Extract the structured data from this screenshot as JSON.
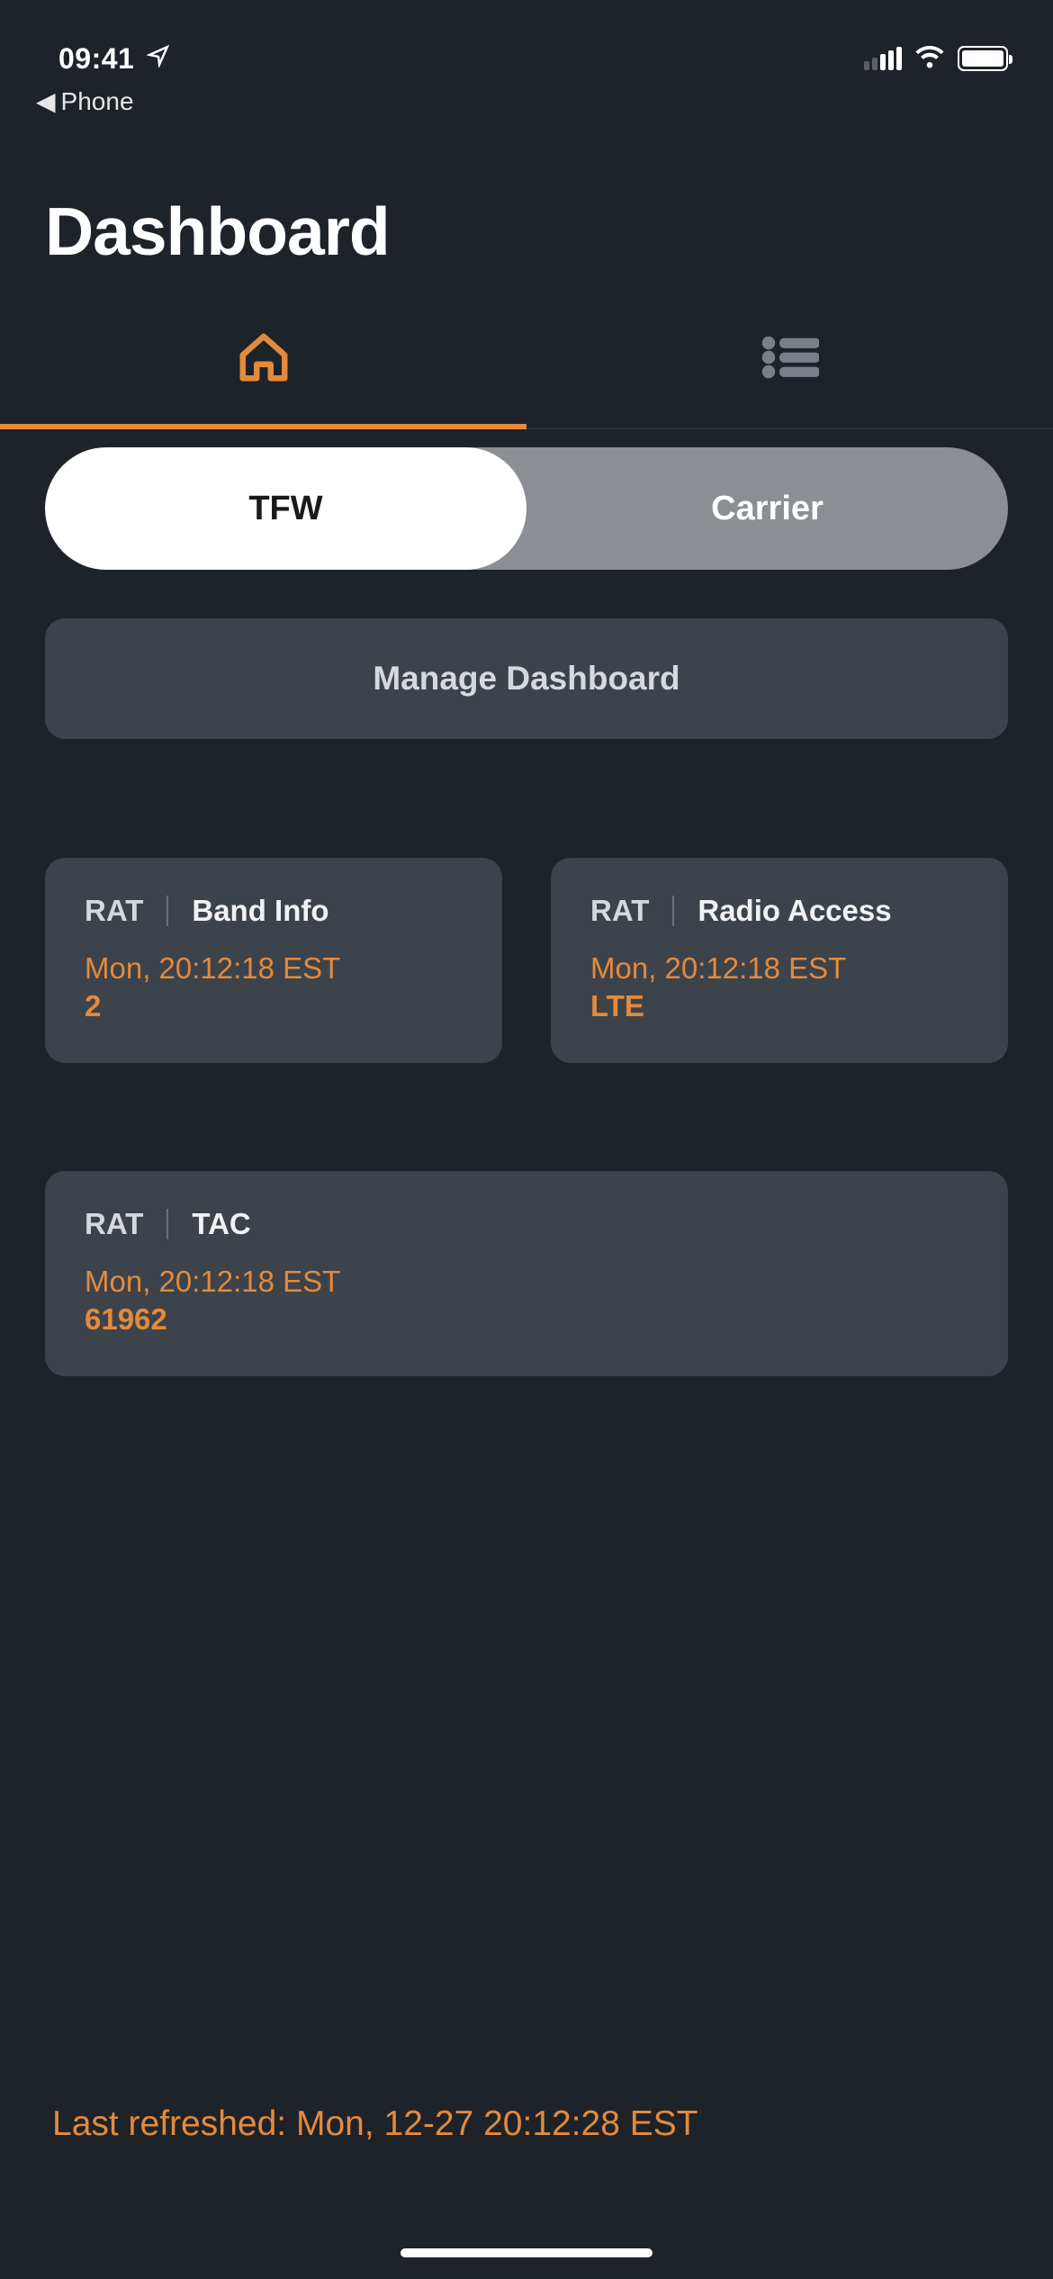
{
  "status_bar": {
    "time": "09:41",
    "back_app": "Phone"
  },
  "page_title": "Dashboard",
  "segmented": {
    "tfw": "TFW",
    "carrier": "Carrier"
  },
  "manage_button": "Manage Dashboard",
  "cards": [
    {
      "category": "RAT",
      "name": "Band Info",
      "timestamp": "Mon, 20:12:18 EST",
      "value": "2"
    },
    {
      "category": "RAT",
      "name": "Radio Access",
      "timestamp": "Mon, 20:12:18 EST",
      "value": "LTE"
    },
    {
      "category": "RAT",
      "name": "TAC",
      "timestamp": "Mon, 20:12:18 EST",
      "value": "61962"
    }
  ],
  "footer_refresh": "Last refreshed: Mon, 12-27 20:12:28 EST",
  "colors": {
    "background": "#1e2329",
    "card": "#3d434b",
    "accent": "#e38a3d"
  }
}
